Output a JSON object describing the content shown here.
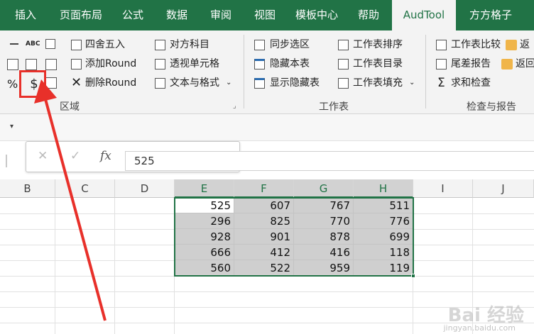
{
  "tabs": [
    {
      "label": "插入",
      "active": false
    },
    {
      "label": "页面布局",
      "active": false
    },
    {
      "label": "公式",
      "active": false
    },
    {
      "label": "数据",
      "active": false
    },
    {
      "label": "审阅",
      "active": false
    },
    {
      "label": "视图",
      "active": false
    },
    {
      "label": "模板中心",
      "active": false
    },
    {
      "label": "帮助",
      "active": false
    },
    {
      "label": "AudTool",
      "active": true
    },
    {
      "label": "方方格子",
      "active": false
    }
  ],
  "ribbon": {
    "region": {
      "label": "区域",
      "abc_glyph": "ABC",
      "percent_glyph": "%",
      "dollar_glyph": "$",
      "items": [
        "四舍五入",
        "添加Round",
        "删除Round"
      ],
      "items2": [
        "对方科目",
        "透视单元格",
        "文本与格式"
      ]
    },
    "sheet": {
      "label": "工作表",
      "items": [
        "同步选区",
        "隐藏本表",
        "显示隐藏表"
      ],
      "items2": [
        "工作表排序",
        "工作表目录",
        "工作表填充"
      ]
    },
    "check": {
      "label": "检查与报告",
      "items": [
        "工作表比较",
        "尾差报告",
        "求和检查"
      ],
      "items2": [
        "返",
        "返回"
      ]
    }
  },
  "formula_bar": {
    "cancel": "✕",
    "enter": "✓",
    "fx": "fx",
    "value": "525"
  },
  "columns": [
    "B",
    "C",
    "D",
    "E",
    "F",
    "G",
    "H",
    "I",
    "J"
  ],
  "selected_columns": [
    "E",
    "F",
    "G",
    "H"
  ],
  "rows": [
    [
      "525",
      "607",
      "767",
      "511"
    ],
    [
      "296",
      "825",
      "770",
      "776"
    ],
    [
      "928",
      "901",
      "878",
      "699"
    ],
    [
      "666",
      "412",
      "416",
      "118"
    ],
    [
      "560",
      "522",
      "959",
      "119"
    ]
  ],
  "watermark": {
    "text": "Bai 经验",
    "sub": "jingyan.baidu.com"
  },
  "colors": {
    "ribbon_green": "#217346",
    "highlight_red": "#e8302a"
  }
}
